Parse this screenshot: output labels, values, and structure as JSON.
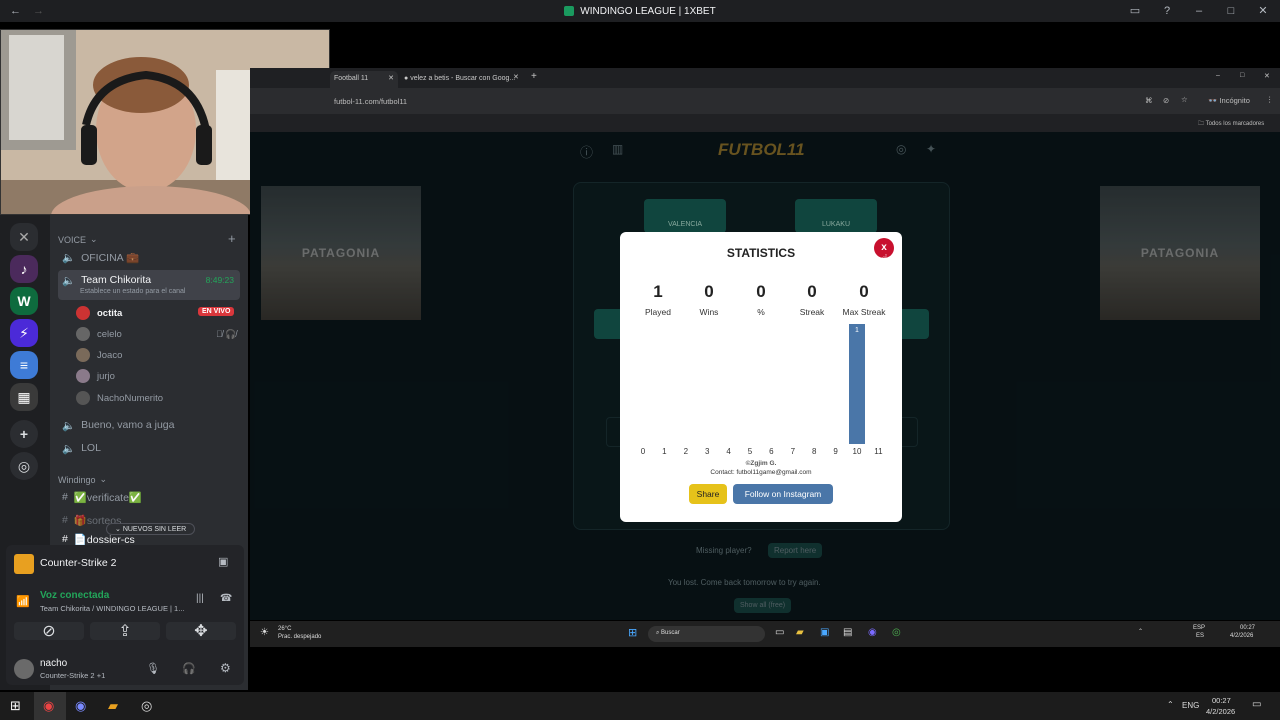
{
  "window": {
    "title": "WINDINGO LEAGUE | 1XBET"
  },
  "discord": {
    "voice_category": "VOICE",
    "channels": {
      "oficina": "OFICINA 💼",
      "team": "Team Chikorita",
      "team_time": "8:49:23",
      "team_status": "Establece un estado para el canal",
      "bueno": "Bueno, vamo a juga",
      "lol": "LOL"
    },
    "users": [
      {
        "name": "octita",
        "live": "EN VIVO"
      },
      {
        "name": "celelo"
      },
      {
        "name": "Joaco"
      },
      {
        "name": "jurjo"
      },
      {
        "name": "NachoNumerito"
      }
    ],
    "category2": "Windingo",
    "text_channels": [
      "✅verificate✅",
      "🎁sorteos",
      "📄dossier-cs"
    ],
    "unread_pill": "NUEVOS SIN LEER",
    "activity": "Counter-Strike 2",
    "voice_status": "Voz conectada",
    "voice_channel": "Team Chikorita / WINDINGO LEAGUE | 1...",
    "self_name": "nacho",
    "self_activity": "Counter-Strike 2 +1",
    "colors": {
      "green": "#23a55a",
      "live_red": "#da373c"
    }
  },
  "browser": {
    "tabs": [
      {
        "label": "Football 11"
      },
      {
        "label": "velez a betis - Buscar con Goog..."
      }
    ],
    "url": "futbol-11.com/futbol11",
    "incognito": "Incógnito",
    "bookmarks": "Todos los marcadores"
  },
  "game": {
    "logo": "FUTBOL11",
    "team_left": "VALENCIA",
    "team_right": "LUKAKU",
    "patagonia": "PATAGONIA",
    "missing": "Missing player?",
    "report": "Report here",
    "lost_msg": "You lost. Come back tomorrow to try again.",
    "reveal": "Show all (free)"
  },
  "modal": {
    "title": "STATISTICS",
    "close": "x",
    "stats": [
      {
        "value": "1",
        "label": "Played"
      },
      {
        "value": "0",
        "label": "Wins"
      },
      {
        "value": "0",
        "label": "%"
      },
      {
        "value": "0",
        "label": "Streak"
      },
      {
        "value": "0",
        "label": "Max Streak"
      }
    ],
    "credit": "©Zgjim G.",
    "contact": "Contact: futbol11game@gmail.com",
    "share": "Share",
    "instagram": "Follow on Instagram",
    "colors": {
      "bar": "#4a76a8",
      "share": "#e6c21a",
      "close": "#c8102e"
    }
  },
  "chart_data": {
    "type": "bar",
    "categories": [
      "0",
      "1",
      "2",
      "3",
      "4",
      "5",
      "6",
      "7",
      "8",
      "9",
      "10",
      "11"
    ],
    "values": [
      0,
      0,
      0,
      0,
      0,
      0,
      0,
      0,
      0,
      0,
      1,
      0
    ],
    "data_labels": [
      "",
      "",
      "",
      "",
      "",
      "",
      "",
      "",
      "",
      "",
      "1",
      ""
    ]
  },
  "inner_taskbar": {
    "weather_temp": "26°C",
    "weather_desc": "Prac. despejado",
    "search": "Buscar",
    "lang": "ESP",
    "lang2": "ES",
    "time": "00:27",
    "date": "4/2/2026"
  },
  "taskbar": {
    "lang": "ENG",
    "time": "00:27",
    "date": "4/2/2026"
  }
}
